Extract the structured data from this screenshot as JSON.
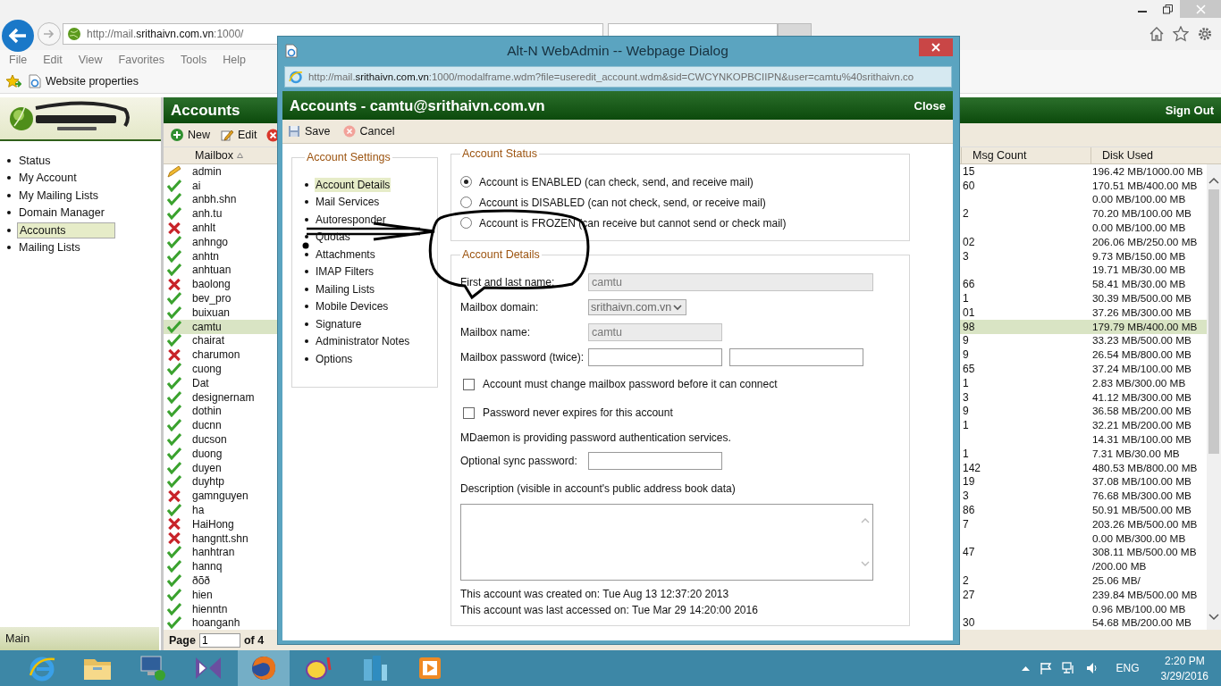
{
  "browser": {
    "address": "http://mail.**srithaivn.com.vn**:1000/",
    "menu": [
      "File",
      "Edit",
      "View",
      "Favorites",
      "Tools",
      "Help"
    ],
    "favorites": [
      "Website properties"
    ]
  },
  "nav": {
    "items": [
      {
        "label": "Status",
        "selected": false
      },
      {
        "label": "My Account",
        "selected": false
      },
      {
        "label": "My Mailing Lists",
        "selected": false
      },
      {
        "label": "Domain Manager",
        "selected": false
      },
      {
        "label": "Accounts",
        "selected": true
      },
      {
        "label": "Mailing Lists",
        "selected": false
      }
    ],
    "footer": "Main"
  },
  "main": {
    "title": "Accounts",
    "sign_out": "Sign Out",
    "toolbar": [
      {
        "kind": "new",
        "label": "New"
      },
      {
        "kind": "edit",
        "label": "Edit"
      }
    ],
    "columns": [
      "Mailbox",
      "Msg Count",
      "Disk Used"
    ],
    "rows": [
      {
        "kind": "admin",
        "mailbox": "admin",
        "msg_count": "15",
        "disk_used": "196.42 MB/1000.00 MB",
        "selected": false
      },
      {
        "kind": "enabled",
        "mailbox": "ai",
        "msg_count": "60",
        "disk_used": "170.51 MB/400.00 MB",
        "selected": false
      },
      {
        "kind": "enabled",
        "mailbox": "anbh.shn",
        "disk_used": "0.00 MB/100.00 MB",
        "selected": false
      },
      {
        "kind": "enabled",
        "mailbox": "anh.tu",
        "msg_count": "2",
        "disk_used": "70.20 MB/100.00 MB",
        "selected": false
      },
      {
        "kind": "disabled",
        "mailbox": "anhlt",
        "disk_used": "0.00 MB/100.00 MB",
        "selected": false
      },
      {
        "kind": "enabled",
        "mailbox": "anhngo",
        "msg_count": "02",
        "disk_used": "206.06 MB/250.00 MB",
        "selected": false
      },
      {
        "kind": "enabled",
        "mailbox": "anhtn",
        "msg_count": "3",
        "disk_used": "9.73 MB/150.00 MB",
        "selected": false
      },
      {
        "kind": "enabled",
        "mailbox": "anhtuan",
        "disk_used": "19.71 MB/30.00 MB",
        "selected": false
      },
      {
        "kind": "disabled",
        "mailbox": "baolong",
        "msg_count": "66",
        "disk_used": "58.41 MB/30.00 MB",
        "selected": false
      },
      {
        "kind": "enabled",
        "mailbox": "bev_pro",
        "msg_count": "1",
        "disk_used": "30.39 MB/500.00 MB",
        "selected": false
      },
      {
        "kind": "enabled",
        "mailbox": "buixuan",
        "msg_count": "01",
        "disk_used": "37.26 MB/300.00 MB",
        "selected": false
      },
      {
        "kind": "enabled",
        "mailbox": "camtu",
        "msg_count": "98",
        "disk_used": "179.79 MB/400.00 MB",
        "selected": true
      },
      {
        "kind": "enabled",
        "mailbox": "chairat",
        "msg_count": "9",
        "disk_used": "33.23 MB/500.00 MB",
        "selected": false
      },
      {
        "kind": "disabled",
        "mailbox": "charumon",
        "msg_count": "9",
        "disk_used": "26.54 MB/800.00 MB",
        "selected": false
      },
      {
        "kind": "enabled",
        "mailbox": "cuong",
        "msg_count": "65",
        "disk_used": "37.24 MB/100.00 MB",
        "selected": false
      },
      {
        "kind": "enabled",
        "mailbox": "Dat",
        "msg_count": "1",
        "disk_used": "2.83 MB/300.00 MB",
        "selected": false
      },
      {
        "kind": "enabled",
        "mailbox": "designernam",
        "msg_count": "3",
        "disk_used": "41.12 MB/300.00 MB",
        "selected": false
      },
      {
        "kind": "enabled",
        "mailbox": "dothin",
        "msg_count": "9",
        "disk_used": "36.58 MB/200.00 MB",
        "selected": false
      },
      {
        "kind": "enabled",
        "mailbox": "ducnn",
        "msg_count": "1",
        "disk_used": "32.21 MB/200.00 MB",
        "selected": false
      },
      {
        "kind": "enabled",
        "mailbox": "ducson",
        "disk_used": "14.31 MB/100.00 MB",
        "selected": false
      },
      {
        "kind": "enabled",
        "mailbox": "duong",
        "msg_count": "1",
        "disk_used": "7.31 MB/30.00 MB",
        "selected": false
      },
      {
        "kind": "enabled",
        "mailbox": "duyen",
        "msg_count": "142",
        "disk_used": "480.53 MB/800.00 MB",
        "selected": false
      },
      {
        "kind": "enabled",
        "mailbox": "duyhtp",
        "msg_count": "19",
        "disk_used": "37.08 MB/100.00 MB",
        "selected": false
      },
      {
        "kind": "disabled",
        "mailbox": "gamnguyen",
        "msg_count": "3",
        "disk_used": "76.68 MB/300.00 MB",
        "selected": false
      },
      {
        "kind": "enabled",
        "mailbox": "ha",
        "msg_count": "86",
        "disk_used": "50.91 MB/500.00 MB",
        "selected": false
      },
      {
        "kind": "disabled",
        "mailbox": "HaiHong",
        "msg_count": "7",
        "disk_used": "203.26 MB/500.00 MB",
        "selected": false
      },
      {
        "kind": "disabled",
        "mailbox": "hangntt.shn",
        "disk_used": "0.00 MB/300.00 MB",
        "selected": false
      },
      {
        "kind": "enabled",
        "mailbox": "hanhtran",
        "msg_count": "47",
        "disk_used": "308.11 MB/500.00 MB",
        "selected": false
      },
      {
        "kind": "enabled",
        "mailbox": "hannq",
        "disk_used": "/200.00 MB",
        "selected": false
      },
      {
        "kind": "enabled",
        "mailbox": "ðõð",
        "msg_count": "2",
        "disk_used": "25.06 MB/",
        "selected": false
      },
      {
        "kind": "enabled",
        "mailbox": "hien",
        "msg_count": "27",
        "disk_used": "239.84 MB/500.00 MB",
        "selected": false
      },
      {
        "kind": "enabled",
        "mailbox": "hienntn",
        "disk_used": "0.96 MB/100.00 MB",
        "selected": false
      },
      {
        "kind": "enabled",
        "mailbox": "hoanganh",
        "msg_count": "30",
        "disk_used": "54.68 MB/200.00 MB",
        "selected": false
      }
    ],
    "pager": {
      "label": "Page",
      "value": "1",
      "total": "of 4"
    }
  },
  "dialog": {
    "title": "Alt-N WebAdmin -- Webpage Dialog",
    "address": "http://mail.**srithaivn.com.vn**:1000/modalframe.wdm?file=useredit_account.wdm&sid=CWCYNKOPBCIIPN&user=camtu%40srithaivn.co",
    "heading": "Accounts - camtu@srithaivn.com.vn",
    "close": "Close",
    "toolbar": [
      {
        "kind": "save",
        "label": "Save"
      },
      {
        "kind": "cancel",
        "label": "Cancel"
      }
    ],
    "settings": {
      "title": "Account Settings",
      "items": [
        {
          "label": "Account Details",
          "selected": true
        },
        {
          "label": "Mail Services",
          "selected": false
        },
        {
          "label": "Autoresponder",
          "selected": false
        },
        {
          "label": "Quotas",
          "selected": false
        },
        {
          "label": "Attachments",
          "selected": false
        },
        {
          "label": "IMAP Filters",
          "selected": false
        },
        {
          "label": "Mailing Lists",
          "selected": false
        },
        {
          "label": "Mobile Devices",
          "selected": false
        },
        {
          "label": "Signature",
          "selected": false
        },
        {
          "label": "Administrator Notes",
          "selected": false
        },
        {
          "label": "Options",
          "selected": false
        }
      ]
    },
    "status": {
      "title": "Account Status",
      "options": [
        {
          "label": "Account is ENABLED (can check, send, and receive mail)",
          "selected": true
        },
        {
          "label": "Account is DISABLED (can not check, send, or receive mail)",
          "selected": false
        },
        {
          "label": "Account is FROZEN (can receive but cannot send or check mail)",
          "selected": false
        }
      ]
    },
    "details": {
      "title": "Account Details",
      "fields": [
        {
          "kind": "text",
          "label": "First and last name:",
          "value": "camtu",
          "disabled": true
        },
        {
          "kind": "select",
          "label": "Mailbox domain:",
          "value": "srithaivn.com.vn",
          "disabled": true
        },
        {
          "kind": "short",
          "label": "Mailbox name:",
          "value": "camtu",
          "disabled": true
        },
        {
          "kind": "password2",
          "label": "Mailbox password (twice):",
          "disabled": false
        }
      ],
      "checks": [
        {
          "label": "Account must change mailbox password before it can connect",
          "checked": false
        },
        {
          "label": "Password never expires for this account",
          "checked": false
        }
      ],
      "auth_note": "MDaemon is providing password authentication services.",
      "sync_label": "Optional sync password:",
      "description_label": "Description (visible in account's public address book data)",
      "created": "This account was created on: Tue Aug 13 12:37:20 2013",
      "accessed": "This account was last accessed on: Tue Mar 29 14:20:00 2016"
    }
  },
  "taskbar": {
    "apps": [
      {
        "kind": "ie",
        "selected": false
      },
      {
        "kind": "folder",
        "selected": false
      },
      {
        "kind": "computer",
        "selected": false
      },
      {
        "kind": "bowtie",
        "selected": false
      },
      {
        "kind": "firefox",
        "selected": true
      },
      {
        "kind": "messenger",
        "selected": false
      },
      {
        "kind": "buildings",
        "selected": false
      },
      {
        "kind": "media",
        "selected": false
      }
    ],
    "language": "ENG",
    "time": "2:20 PM",
    "date": "3/29/2016"
  }
}
